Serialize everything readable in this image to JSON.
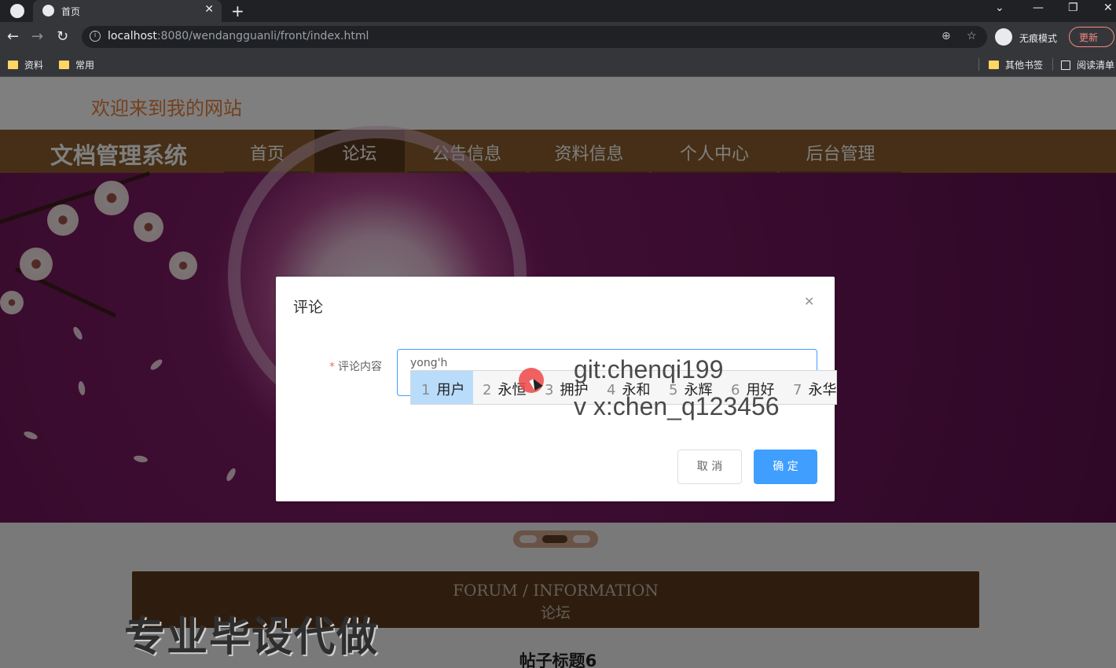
{
  "browser": {
    "tab_title": "首页",
    "url_host": "localhost",
    "url_rest": ":8080/wendangguanli/front/index.html",
    "incognito_label": "无痕模式",
    "update_label": "更新",
    "bookmarks": [
      "资料",
      "常用"
    ],
    "other_bookmarks": "其他书签",
    "reading_list": "阅读清单"
  },
  "site": {
    "welcome": "欢迎来到我的网站",
    "brand": "文档管理系统",
    "nav": [
      "首页",
      "论坛",
      "公告信息",
      "资料信息",
      "个人中心",
      "后台管理"
    ],
    "active_nav": "论坛"
  },
  "forum": {
    "title_en": "FORUM / INFORMATION",
    "title_cn": "论坛",
    "post_title": "帖子标题6"
  },
  "dialog": {
    "title": "评论",
    "field_label": "评论内容",
    "field_value": "yong'h",
    "cancel_label": "取 消",
    "confirm_label": "确 定"
  },
  "ime": {
    "candidates": [
      {
        "num": "1",
        "text": "用户"
      },
      {
        "num": "2",
        "text": "永恒"
      },
      {
        "num": "3",
        "text": "拥护"
      },
      {
        "num": "4",
        "text": "永和"
      },
      {
        "num": "5",
        "text": "永辉"
      },
      {
        "num": "6",
        "text": "用好"
      },
      {
        "num": "7",
        "text": "永华"
      }
    ]
  },
  "watermark": {
    "git": "git:chenqi199",
    "vx": "v x:chen_q123456",
    "promo": "专业毕设代做"
  },
  "colors": {
    "nav_bg": "#8c5e2c",
    "accent": "#409eff",
    "welcome": "#e8803a"
  }
}
